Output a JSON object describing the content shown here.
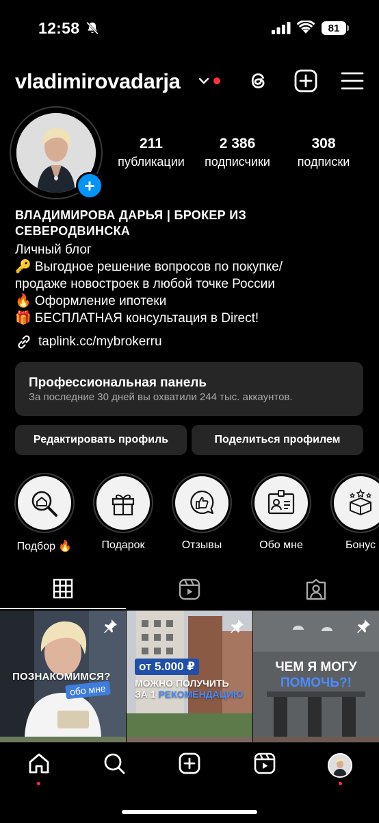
{
  "status_bar": {
    "time": "12:58",
    "battery": "81",
    "icons": [
      "bell-slash-icon",
      "cell-signal-icon",
      "wifi-icon",
      "battery-icon"
    ]
  },
  "header": {
    "username": "vladimirovadarja",
    "icons": [
      "chevron-down-icon",
      "threads-icon",
      "create-plus-icon",
      "menu-icon"
    ]
  },
  "profile": {
    "stats": [
      {
        "value": "211",
        "label": "публикации"
      },
      {
        "value": "2 386",
        "label": "подписчики"
      },
      {
        "value": "308",
        "label": "подписки"
      }
    ],
    "name_line1": "ВЛАДИМИРОВА ДАРЬЯ | БРОКЕР ИЗ",
    "name_line2": "СЕВЕРОДВИНСКА",
    "bio": [
      "Личный блог",
      "🔑 Выгодное решение вопросов по покупке/",
      "продаже новостроек в любой точке России",
      "🔥 Оформление ипотеки",
      "🎁 БЕСПЛАТНАЯ консультация в Direct!"
    ],
    "link": "taplink.cc/mybrokerru"
  },
  "pro_panel": {
    "title": "Профессиональная панель",
    "subtitle": "За последние 30 дней вы охватили 244 тыс. аккаунтов."
  },
  "buttons": {
    "edit": "Редактировать профиль",
    "share": "Поделиться профилем"
  },
  "highlights": [
    {
      "label": "Подбор 🔥",
      "icon": "house-search-icon"
    },
    {
      "label": "Подарок",
      "icon": "gift-icon"
    },
    {
      "label": "Отзывы",
      "icon": "thumbs-up-bubble-icon"
    },
    {
      "label": "Обо мне",
      "icon": "id-card-icon"
    },
    {
      "label": "Бонус",
      "icon": "gift-box-stars-icon"
    }
  ],
  "tabs": [
    "grid-icon",
    "reels-icon",
    "tagged-icon"
  ],
  "posts": [
    {
      "line1": "ПОЗНАКОМИМСЯ?",
      "tag": "обо мне"
    },
    {
      "tag": "от 5.000 ₽",
      "line1": "МОЖНО ПОЛУЧИТЬ",
      "line2a": "ЗА 1 ",
      "line2b": "РЕКОМЕНДАЦИЮ"
    },
    {
      "line1": "ЧЕМ Я МОГУ",
      "line2": "ПОМОЧЬ?!"
    }
  ],
  "bottom_nav": [
    "home-icon",
    "search-icon",
    "create-icon",
    "reels-icon",
    "profile-avatar"
  ]
}
